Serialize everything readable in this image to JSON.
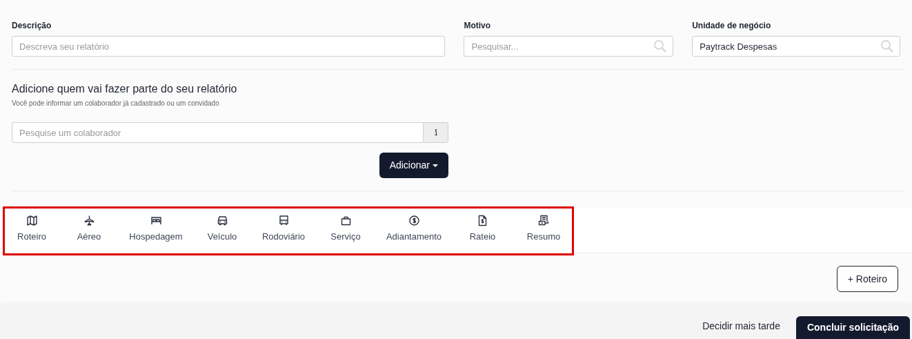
{
  "fields": [
    {
      "label": "Descrição",
      "placeholder": "Descreva seu relatório",
      "search": false
    },
    {
      "label": "Motivo",
      "placeholder": "Pesquisar...",
      "search": true
    },
    {
      "label": "Unidade de negócio",
      "value": "Paytrack Despesas",
      "search": true
    }
  ],
  "participants": {
    "title": "Adicione quem vai fazer parte do seu relatório",
    "subtitle": "Você pode informar um colaborador já cadastrado ou um convidado",
    "search_placeholder": "Pesquise um colaborador",
    "add_button": "Adicionar"
  },
  "tabs": [
    {
      "label": "Roteiro",
      "kind": "map",
      "selected": false
    },
    {
      "label": "Aéreo",
      "kind": "plane",
      "selected": false
    },
    {
      "label": "Hospedagem",
      "kind": "bed",
      "selected": false
    },
    {
      "label": "Veículo",
      "kind": "car",
      "selected": false
    },
    {
      "label": "Rodoviário",
      "kind": "bus",
      "selected": false
    },
    {
      "label": "Serviço",
      "kind": "bag",
      "selected": false
    },
    {
      "label": "Adiantamento",
      "kind": "dollar",
      "selected": false
    },
    {
      "label": "Rateio",
      "kind": "doc",
      "selected": false
    },
    {
      "label": "Resumo",
      "kind": "receipt",
      "selected": false
    }
  ],
  "add_item_button": "+ Roteiro",
  "footer": {
    "later": "Decidir mais tarde",
    "submit": "Concluir solicitação"
  }
}
